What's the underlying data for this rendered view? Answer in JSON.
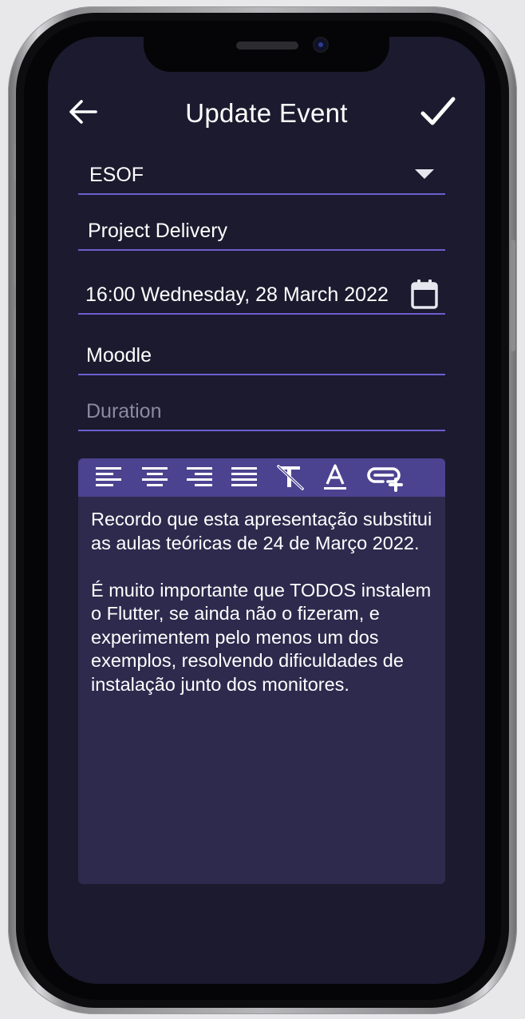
{
  "header": {
    "title": "Update Event",
    "back_icon": "arrow-left-icon",
    "confirm_icon": "checkmark-icon"
  },
  "form": {
    "course": {
      "value": "ESOF",
      "icon": "dropdown-arrow-icon"
    },
    "event_name": {
      "value": "Project Delivery"
    },
    "datetime": {
      "value": "16:00 Wednesday, 28 March 2022",
      "icon": "calendar-icon"
    },
    "location": {
      "value": "Moodle"
    },
    "duration": {
      "value": "",
      "placeholder": "Duration"
    }
  },
  "editor": {
    "toolbar": [
      "align-left-icon",
      "align-center-icon",
      "align-right-icon",
      "align-justify-icon",
      "clear-format-icon",
      "text-color-icon",
      "insert-link-icon"
    ],
    "paragraphs": [
      "Recordo que esta apresentação substitui as aulas teóricas de 24 de Março 2022.",
      "É muito importante que TODOS instalem o Flutter, se ainda não o fizeram, e experimentem pelo menos um dos exemplos, resolvendo dificuldades de instalação junto dos monitores."
    ]
  },
  "colors": {
    "background": "#1c1a2e",
    "accent_line": "#6b5fd0",
    "toolbar": "#4b4390",
    "editor_bg": "#2d2a4d",
    "text": "#ffffff"
  }
}
